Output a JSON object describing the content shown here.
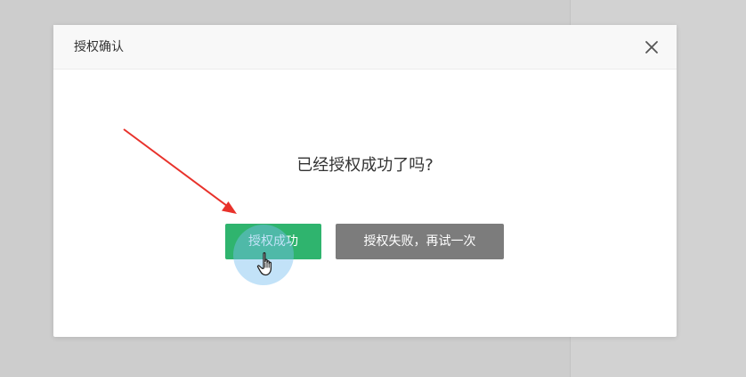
{
  "dialog": {
    "title": "授权确认",
    "question": "已经授权成功了吗?",
    "success_button_label": "授权成功",
    "fail_button_label": "授权失败，再试一次"
  },
  "icons": {
    "close": "close-icon",
    "cursor": "hand-cursor-icon",
    "annotation": "red-arrow"
  },
  "colors": {
    "success": "#2fb46e",
    "fail": "#7c7c7c",
    "arrow": "#e8322b"
  }
}
